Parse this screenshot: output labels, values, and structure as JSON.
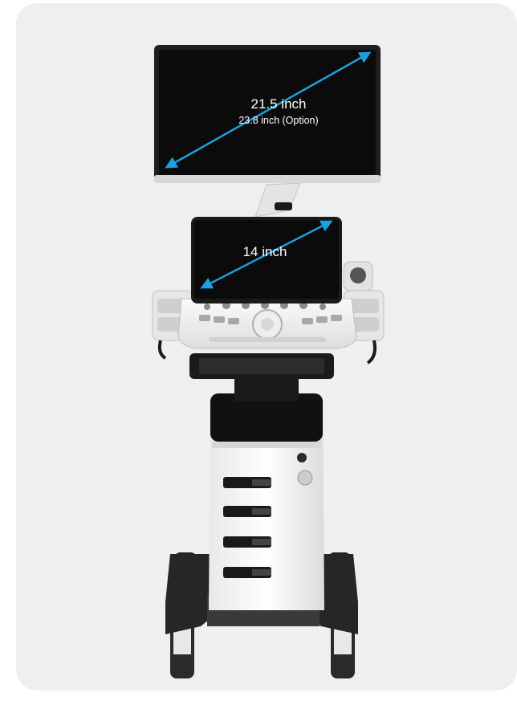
{
  "main_monitor": {
    "size_label": "21.5 inch",
    "option_label": "23.8 inch (Option)"
  },
  "touch_screen": {
    "size_label": "14 inch"
  },
  "colors": {
    "background": "#efefef",
    "arrow": "#1e9fe0",
    "screen": "#0b0b0b"
  },
  "icons": [
    "double-arrow-icon"
  ]
}
